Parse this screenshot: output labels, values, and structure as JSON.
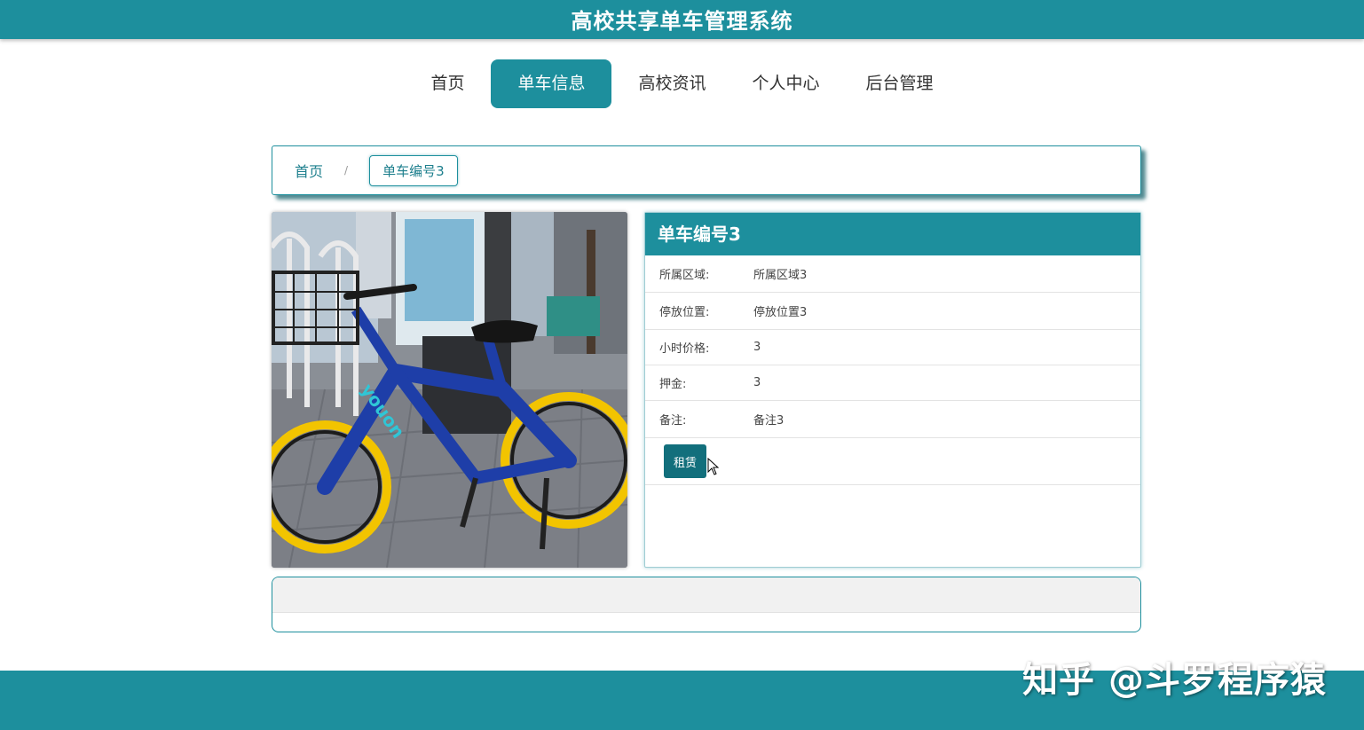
{
  "header": {
    "title": "高校共享单车管理系统"
  },
  "nav": {
    "items": [
      {
        "label": "首页",
        "active": false
      },
      {
        "label": "单车信息",
        "active": true
      },
      {
        "label": "高校资讯",
        "active": false
      },
      {
        "label": "个人中心",
        "active": false
      },
      {
        "label": "后台管理",
        "active": false
      }
    ]
  },
  "breadcrumb": {
    "home": "首页",
    "separator": "/",
    "current": "单车编号3"
  },
  "detail": {
    "title": "单车编号3",
    "fields": [
      {
        "label": "所属区域:",
        "value": "所属区域3"
      },
      {
        "label": "停放位置:",
        "value": "停放位置3"
      },
      {
        "label": "小时价格:",
        "value": "3"
      },
      {
        "label": "押金:",
        "value": "3"
      },
      {
        "label": "备注:",
        "value": "备注3"
      }
    ],
    "rent_button": "租赁"
  },
  "watermark": "知乎 @斗罗程序猿",
  "colors": {
    "primary": "#1d8f9d",
    "button": "#126f7c"
  },
  "photo": {
    "icon": "bike-photo",
    "brand_text": "youon"
  }
}
